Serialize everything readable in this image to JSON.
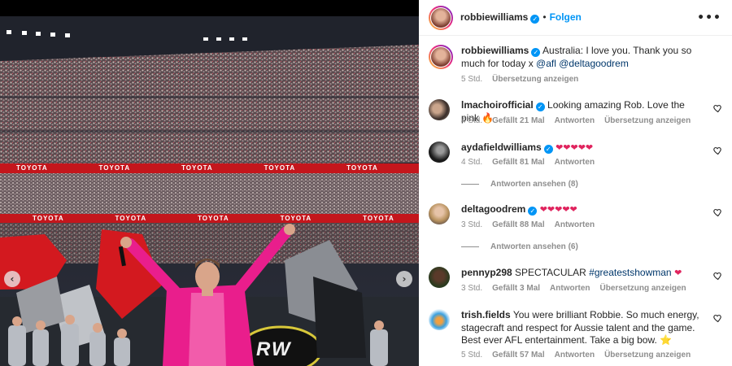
{
  "post": {
    "author": "robbiewilliams",
    "follow_label": "Folgen",
    "caption_text": "Australia: I love you. Thank you so much for today x ",
    "caption_mentions": [
      "@afl",
      "@deltagoodrem"
    ],
    "time": "5 Std.",
    "translate_label": "Übersetzung anzeigen"
  },
  "comments": [
    {
      "user": "lmachoirofficial",
      "verified": true,
      "text": "Looking amazing Rob. Love the pink 🔥",
      "time": "4 Std.",
      "likes": "Gefällt 21 Mal",
      "reply_label": "Antworten",
      "translate_label": "Übersetzung anzeigen"
    },
    {
      "user": "aydafieldwilliams",
      "verified": true,
      "text": "❤❤❤❤❤",
      "time": "4 Std.",
      "likes": "Gefällt 81 Mal",
      "reply_label": "Antworten",
      "view_replies": "Antworten ansehen (8)"
    },
    {
      "user": "deltagoodrem",
      "verified": true,
      "text": "❤❤❤❤❤",
      "time": "3 Std.",
      "likes": "Gefällt 88 Mal",
      "reply_label": "Antworten",
      "view_replies": "Antworten ansehen (6)"
    },
    {
      "user": "pennyp298",
      "verified": false,
      "text_before": "SPECTACULAR ",
      "hashtag": "#greatestshowman",
      "text_after": " ❤",
      "time": "3 Std.",
      "likes": "Gefällt 3 Mal",
      "reply_label": "Antworten",
      "translate_label": "Übersetzung anzeigen"
    },
    {
      "user": "trish.fields",
      "verified": false,
      "text": "You were brilliant Robbie. So much energy, stagecraft and respect for Aussie talent and the game. Best ever AFL entertainment. Take a big bow. ⭐",
      "time": "5 Std.",
      "likes": "Gefällt 57 Mal",
      "reply_label": "Antworten",
      "translate_label": "Übersetzung anzeigen"
    }
  ],
  "media": {
    "banner_text": "TOYOTA",
    "stage_logo_text": "RW",
    "prev_icon": "chevron-left-icon",
    "next_icon": "chevron-right-icon"
  },
  "colors": {
    "accent": "#0095f6",
    "pink_suit": "#e91e8c",
    "flag_red": "#d3191f",
    "banner_red": "#c4161c"
  }
}
